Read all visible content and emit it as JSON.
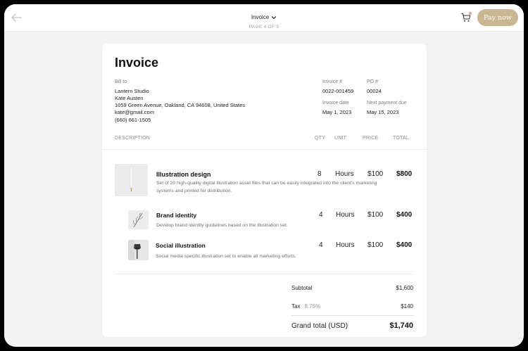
{
  "colors": {
    "accent": "#c9b791",
    "cart_dot": "#e0a98b"
  },
  "topbar": {
    "title": "Invoice",
    "page_indicator": "PAGE 4 OF 5",
    "pay_label": "Pay now"
  },
  "invoice": {
    "title": "Invoice",
    "bill_to": {
      "label": "Bill to",
      "lines": [
        "Lantern Studio",
        "Kate Austen",
        "1059 Green Avenue, Oakland, CA 94608, United States",
        "kate@gmail.com",
        "(660) 661-1505"
      ]
    },
    "meta": {
      "invoice_no_label": "Invoice #",
      "invoice_no": "0022-001459",
      "po_label": "PO #",
      "po": "00024",
      "invoice_date_label": "Invoice date",
      "invoice_date": "May 1, 2023",
      "next_due_label": "Next payment due",
      "next_due": "May 15, 2023"
    },
    "columns": {
      "description": "DESCRIPTION",
      "qty": "QTY",
      "unit": "UNIT",
      "price": "PRICE",
      "total": "TOTAL"
    },
    "items": [
      {
        "name": "Illustration design",
        "description": "Set of 20 high-quality digital illustration asset files that can be easily integrated into the client's marketing systems and printed for distribution.",
        "qty": "8",
        "unit": "Hours",
        "price": "$100",
        "total": "$800",
        "thumb_icon": "pencil-icon"
      },
      {
        "name": "Brand identity",
        "description": "Develop brand identity guidelines based on the illustration set.",
        "qty": "4",
        "unit": "Hours",
        "price": "$100",
        "total": "$400",
        "thumb_icon": "leaf-icon"
      },
      {
        "name": "Social illustration",
        "description": "Social media specific illustration set to enable all marketing efforts.",
        "qty": "4",
        "unit": "Hours",
        "price": "$100",
        "total": "$400",
        "thumb_icon": "lamp-icon"
      }
    ],
    "summary": {
      "subtotal_label": "Subtotal",
      "subtotal": "$1,600",
      "tax_label": "Tax",
      "tax_rate": "8.75%",
      "tax": "$140",
      "grand_total_label": "Grand total (USD)",
      "grand_total": "$1,740"
    }
  }
}
